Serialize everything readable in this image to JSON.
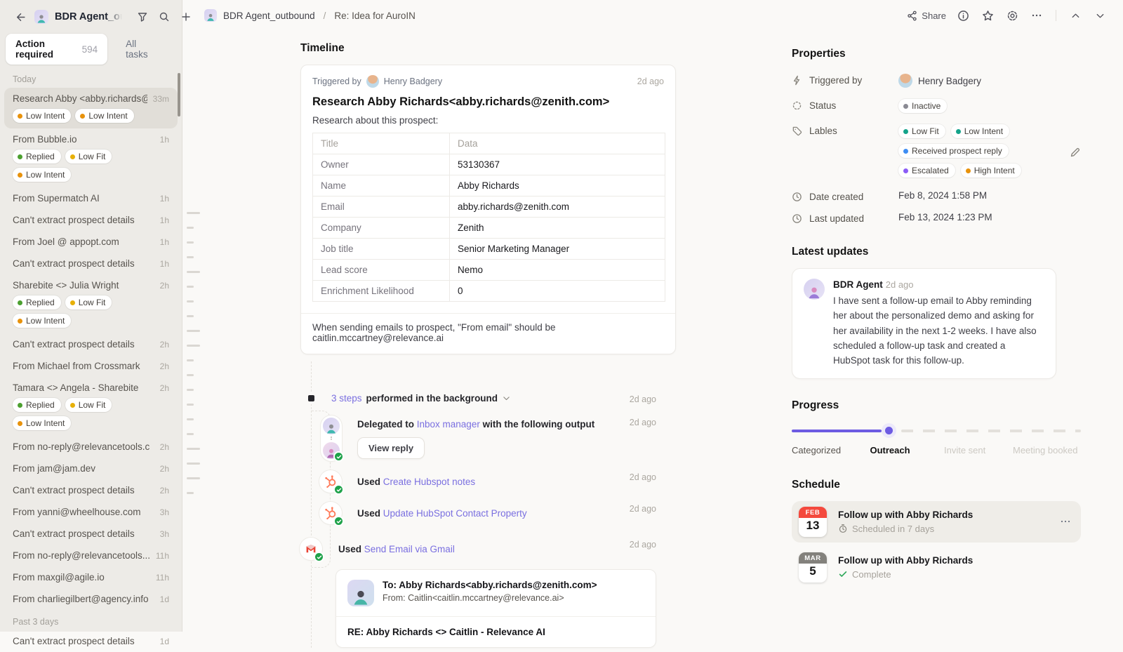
{
  "colors": {
    "accent_purple": "#6D5BE2",
    "link_purple": "#7A6FE0",
    "success_green": "#1FA24A",
    "hubspot_orange": "#FF7A59",
    "gmail_red": "#EA4335",
    "calendar_red": "#F4493D",
    "dot_green": "#4CA030",
    "dot_yellow": "#E7B008",
    "dot_orange": "#E8920C",
    "dot_teal": "#14A38A",
    "dot_blue": "#3E8DF3",
    "dot_purple": "#8B5CF6",
    "dot_gray": "#8A8A93"
  },
  "sidebar": {
    "title": "BDR Agent_out",
    "tabs": {
      "action_required": "Action required",
      "count": "594",
      "all_tasks": "All tasks"
    },
    "sections": [
      {
        "label": "Today",
        "items": [
          {
            "title": "Research Abby <abby.richards@",
            "time": "33m",
            "badges": [
              {
                "label": "Low Intent",
                "color": "orange"
              },
              {
                "label": "Low Intent",
                "color": "orange"
              }
            ]
          },
          {
            "title": "From Bubble.io",
            "time": "1h",
            "badges": [
              {
                "label": "Replied",
                "color": "green"
              },
              {
                "label": "Low Fit",
                "color": "yellow"
              },
              {
                "label": "Low Intent",
                "color": "orange"
              }
            ]
          },
          {
            "title": "From Supermatch AI",
            "time": "1h"
          },
          {
            "title": "Can't extract prospect details",
            "time": "1h"
          },
          {
            "title": "From Joel @ appopt.com",
            "time": "1h"
          },
          {
            "title": "Can't extract prospect details",
            "time": "1h"
          },
          {
            "title": "Sharebite <> Julia Wright",
            "time": "2h",
            "badges": [
              {
                "label": "Replied",
                "color": "green"
              },
              {
                "label": "Low Fit",
                "color": "yellow"
              },
              {
                "label": "Low Intent",
                "color": "orange"
              }
            ]
          },
          {
            "title": "Can't extract prospect details",
            "time": "2h"
          },
          {
            "title": "From Michael from Crossmark",
            "time": "2h"
          },
          {
            "title": "Tamara <> Angela - Sharebite",
            "time": "2h",
            "badges": [
              {
                "label": "Replied",
                "color": "green"
              },
              {
                "label": "Low Fit",
                "color": "yellow"
              },
              {
                "label": "Low Intent",
                "color": "orange"
              }
            ]
          },
          {
            "title": "From no-reply@relevancetools.c",
            "time": "2h"
          },
          {
            "title": "From jam@jam.dev",
            "time": "2h"
          },
          {
            "title": "Can't extract prospect details",
            "time": "2h"
          },
          {
            "title": "From yanni@wheelhouse.com",
            "time": "3h"
          },
          {
            "title": "Can't extract prospect details",
            "time": "3h"
          },
          {
            "title": "From no-reply@relevancetools...",
            "time": "11h"
          },
          {
            "title": "From maxgil@agile.io",
            "time": "11h"
          },
          {
            "title": "From charliegilbert@agency.info",
            "time": "1d"
          }
        ]
      },
      {
        "label": "Past 3 days",
        "items": [
          {
            "title": "Can't extract prospect details",
            "time": "1d"
          }
        ]
      }
    ]
  },
  "header": {
    "breadcrumb": {
      "agent": "BDR Agent_outbound",
      "separator": "/",
      "task": "Re: Idea for AuroIN"
    },
    "share_label": "Share"
  },
  "timeline": {
    "heading": "Timeline",
    "card": {
      "triggered_by_label": "Triggered by",
      "triggered_by_name": "Henry Badgery",
      "time": "2d ago",
      "title": "Research Abby Richards<abby.richards@zenith.com>",
      "subtitle": "Research about this prospect:",
      "table": {
        "headers": [
          "Title",
          "Data"
        ],
        "rows": [
          [
            "Owner",
            "53130367"
          ],
          [
            "Name",
            "Abby Richards"
          ],
          [
            "Email",
            "abby.richards@zenith.com"
          ],
          [
            "Company",
            "Zenith"
          ],
          [
            "Job title",
            "Senior Marketing Manager"
          ],
          [
            "Lead score",
            "Nemo"
          ],
          [
            "Enrichment Likelihood",
            "0"
          ]
        ]
      },
      "footer": "When sending emails to prospect, \"From email\" should be caitlin.mccartney@relevance.ai"
    },
    "steps": {
      "group": {
        "link": "3 steps",
        "rest": " performed in the background",
        "time": "2d ago"
      },
      "delegated": {
        "pre": "Delegated to ",
        "link": "Inbox manager",
        "post": " with the following output",
        "time": "2d ago",
        "button": "View reply"
      },
      "used": [
        {
          "pre": "Used ",
          "link": "Create Hubspot notes",
          "time": "2d ago"
        },
        {
          "pre": "Used ",
          "link": "Update HubSpot Contact Property",
          "time": "2d ago"
        }
      ],
      "gmail": {
        "pre": "Used ",
        "link": "Send Email via Gmail",
        "time": "2d ago"
      },
      "email": {
        "to": "To: Abby Richards<abby.richards@zenith.com>",
        "from": "From: Caitlin<caitlin.mccartney@relevance.ai>",
        "subject": "RE: Abby Richards <> Caitlin - Relevance AI"
      }
    }
  },
  "properties": {
    "heading": "Properties",
    "triggered_by": {
      "label": "Triggered by",
      "value": "Henry Badgery"
    },
    "status": {
      "label": "Status",
      "value": "Inactive"
    },
    "labels": {
      "label": "Lables",
      "badges": [
        {
          "label": "Low Fit",
          "color": "teal"
        },
        {
          "label": "Low Intent",
          "color": "teal"
        },
        {
          "label": "Received prospect reply",
          "color": "blue"
        },
        {
          "label": "Escalated",
          "color": "purple"
        },
        {
          "label": "High Intent",
          "color": "orange"
        }
      ]
    },
    "date_created": {
      "label": "Date created",
      "value": "Feb 8, 2024 1:58 PM"
    },
    "last_updated": {
      "label": "Last updated",
      "value": "Feb 13, 2024 1:23 PM"
    }
  },
  "latest_updates": {
    "heading": "Latest updates",
    "author": "BDR Agent",
    "time": "2d ago",
    "body": "I have sent a follow-up email to Abby reminding her about the personalized demo and asking for her availability in the next 1-2 weeks. I have also scheduled a follow-up task and created a HubSpot task for this follow-up."
  },
  "progress": {
    "heading": "Progress",
    "stages": [
      {
        "label": "Categorized",
        "state": "done"
      },
      {
        "label": "Outreach",
        "state": "current"
      },
      {
        "label": "Invite sent",
        "state": "upcoming"
      },
      {
        "label": "Meeting booked",
        "state": "upcoming"
      }
    ]
  },
  "schedule": {
    "heading": "Schedule",
    "items": [
      {
        "month": "FEB",
        "day": "13",
        "title": "Follow up with Abby Richards",
        "status": "Scheduled in 7 days",
        "highlighted": true
      },
      {
        "month": "MAR",
        "day": "5",
        "title": "Follow up with Abby Richards",
        "status": "Complete",
        "highlighted": false
      }
    ]
  }
}
